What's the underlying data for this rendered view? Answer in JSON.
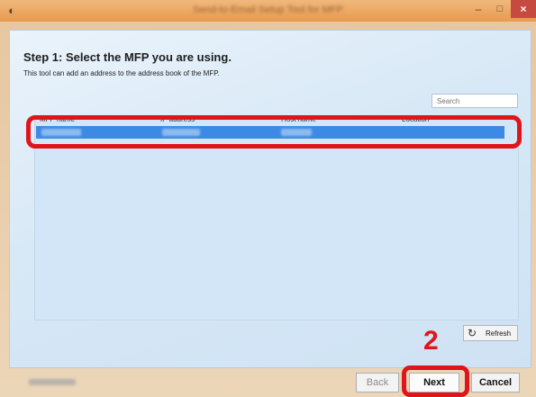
{
  "window": {
    "title": "Send-to-Email Setup Tool for MFP",
    "app_icon": "disc-icon",
    "controls": {
      "minimize": "–",
      "maximize": "□",
      "close": "×"
    }
  },
  "header": {
    "step_title": "Step 1: Select the MFP you are using.",
    "description": "This tool can add an address to the address book of the MFP."
  },
  "search": {
    "placeholder": "Search"
  },
  "table": {
    "columns": [
      "MFP name",
      "IP address",
      "Host name",
      "Location"
    ],
    "rows": [
      {
        "selected": true,
        "cells": [
          "",
          "",
          "",
          ""
        ]
      }
    ]
  },
  "refresh": {
    "label": "Refresh",
    "icon": "refresh-icon"
  },
  "annotation": {
    "step_number": "2",
    "color": "#e0151b"
  },
  "footer": {
    "back_label": "Back",
    "next_label": "Next",
    "cancel_label": "Cancel"
  },
  "colors": {
    "selection": "#3d8ae4",
    "titlebar": "#e89a4e",
    "close_button": "#c74a40",
    "highlight": "#e0151b"
  }
}
